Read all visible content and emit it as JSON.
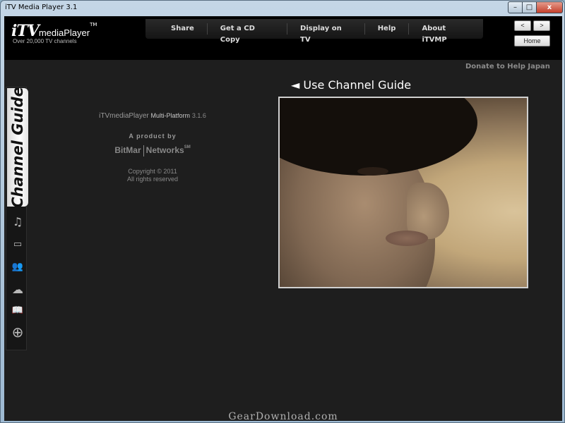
{
  "window": {
    "title": "iTV Media Player 3.1",
    "minimize_glyph": "–",
    "maximize_glyph": "□",
    "close_glyph": "x"
  },
  "header": {
    "logo_main": "iTV",
    "logo_sub": "mediaPlayer",
    "logo_tm": "TM",
    "tagline": "Over 20,000 TV channels",
    "nav": {
      "share": "Share",
      "cd_copy": "Get a CD Copy",
      "display_tv": "Display on TV",
      "help": "Help",
      "about": "About iTVMP"
    },
    "back_label": "<",
    "forward_label": ">",
    "home_label": "Home"
  },
  "donate_link": "Donate to Help Japan",
  "sidebar": {
    "channel_guide_tab": "Channel Guide",
    "icons": [
      "music-icon",
      "games-icon",
      "people-icon",
      "weather-icon",
      "book-icon",
      "globe-icon"
    ],
    "icon_glyphs": {
      "music": "♫",
      "games": "▭",
      "people": "👥",
      "weather": "☁",
      "book": "📖",
      "globe": "⊕"
    }
  },
  "info": {
    "product_name": "iTVmediaPlayer",
    "product_platform": "Multi-Platform",
    "product_version": "3.1.6",
    "by_label": "A product by",
    "brand_left": "BitMar",
    "brand_right": "Networks",
    "brand_mark": "SM",
    "copyright": "Copyright © 2011",
    "rights": "All rights reserved"
  },
  "guide_link": "◄ Use Channel Guide",
  "watermark": "GearDownload.com"
}
